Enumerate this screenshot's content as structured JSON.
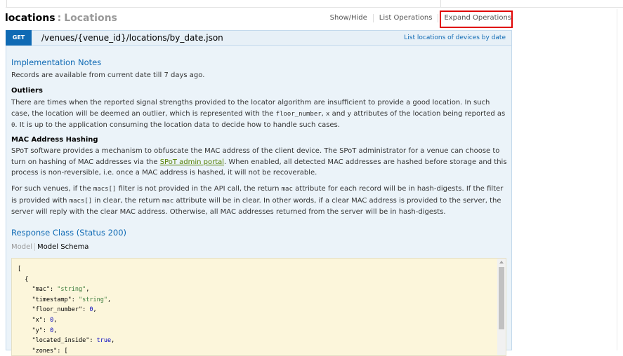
{
  "resource": {
    "name": "locations",
    "separator": ":",
    "description": "Locations"
  },
  "operations_menu": {
    "show_hide": "Show/Hide",
    "list_operations": "List Operations",
    "expand_operations": "Expand Operations"
  },
  "endpoint": {
    "method": "GET",
    "path": "/venues/{venue_id}/locations/by_date.json",
    "summary": "List locations of devices by date"
  },
  "implementation": {
    "heading": "Implementation Notes",
    "intro": "Records are available from current date till 7 days ago.",
    "outliers_heading": "Outliers",
    "outliers_t1": "There are times when the reported signal strengths provided to the locator algorithm are insufficient to provide a good location. In such case, the location will be deemed an outlier, which is represented with the ",
    "outliers_c1": "floor_number",
    "outliers_t2": ", ",
    "outliers_c2": "x",
    "outliers_t3": " and ",
    "outliers_c3": "y",
    "outliers_t4": " attributes of the location being reported as ",
    "outliers_c4": "0",
    "outliers_t5": ". It is up to the application consuming the location data to decide how to handle such cases.",
    "mac_heading": "MAC Address Hashing",
    "mac_t1": "SPoT software provides a mechanism to obfuscate the MAC address of the client device. The SPoT administrator for a venue can choose to turn on hashing of MAC addresses via the ",
    "mac_link": "SPoT admin portal",
    "mac_t2": ". When enabled, all detected MAC addresses are hashed before storage and this process is non-reversible, i.e. once a MAC address is hashed, it will not be recoverable.",
    "venues_t1": "For such venues, if the ",
    "venues_c1": "macs[]",
    "venues_t2": " filter is not provided in the API call, the return ",
    "venues_c2": "mac",
    "venues_t3": " attribute for each record will be in hash-digests. If the filter is provided with ",
    "venues_c3": "macs[]",
    "venues_t4": " in clear, the return ",
    "venues_c4": "mac",
    "venues_t5": " attribute will be in clear. In other words, if a clear MAC address is provided to the server, the server will reply with the clear MAC address. Otherwise, all MAC addresses returned from the server will be in hash-digests."
  },
  "response": {
    "heading": "Response Class (Status 200)",
    "tab_model": "Model",
    "tab_schema": "Model Schema",
    "schema_lines": [
      "[",
      "  {",
      "    \"mac\": \"string\",",
      "    \"timestamp\": \"string\",",
      "    \"floor_number\": 0,",
      "    \"x\": 0,",
      "    \"y\": 0,",
      "    \"located_inside\": true,",
      "    \"zones\": ["
    ]
  },
  "colors": {
    "method_get": "#0f6ab4",
    "highlight": "#e00000",
    "link": "#547f00"
  }
}
